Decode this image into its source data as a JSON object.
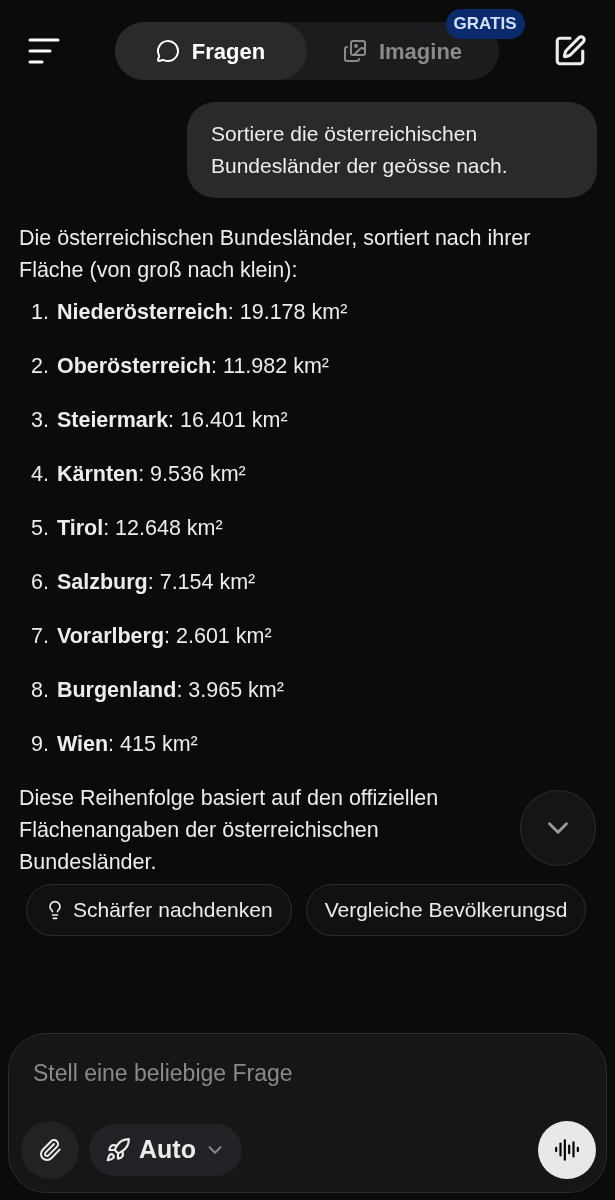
{
  "header": {
    "tabs": [
      {
        "label": "Fragen",
        "selected": true,
        "kind": "chat"
      },
      {
        "label": "Imagine",
        "selected": false,
        "kind": "image"
      }
    ],
    "badge": "GRATIS"
  },
  "user_message": "Sortiere die österreichischen Bundesländer der geösse nach.",
  "answer": {
    "intro": "Die österreichischen Bundesländer, sortiert nach ihrer Fläche (von groß nach klein):",
    "items": [
      {
        "number": "1.",
        "text": "**Niederösterreich**: 19.178 km²"
      },
      {
        "number": "2.",
        "text": "**Oberösterreich**: 11.982 km²"
      },
      {
        "number": "3.",
        "text": "**Steiermark**: 16.401 km²"
      },
      {
        "number": "4.",
        "text": "**Kärnten**: 9.536 km²"
      },
      {
        "number": "5.",
        "text": "**Tirol**: 12.648 km²"
      },
      {
        "number": "6.",
        "text": "**Salzburg**: 7.154 km²"
      },
      {
        "number": "7.",
        "text": "**Vorarlberg**: 2.601 km²"
      },
      {
        "number": "8.",
        "text": "**Burgenland**: 3.965 km²"
      },
      {
        "number": "9.",
        "text": "**Wien**: 415 km²"
      }
    ],
    "outro": "Diese Reihenfolge basiert auf den offiziellen Flächenangaben der österreichischen Bundesländer."
  },
  "suggestions": [
    {
      "label": "Schärfer nachdenken",
      "kind": "think"
    },
    {
      "label": "Vergleiche Bevölkerungsd",
      "kind": "plain"
    }
  ],
  "composer": {
    "placeholder": "Stell eine beliebige Frage",
    "mode": "Auto"
  }
}
